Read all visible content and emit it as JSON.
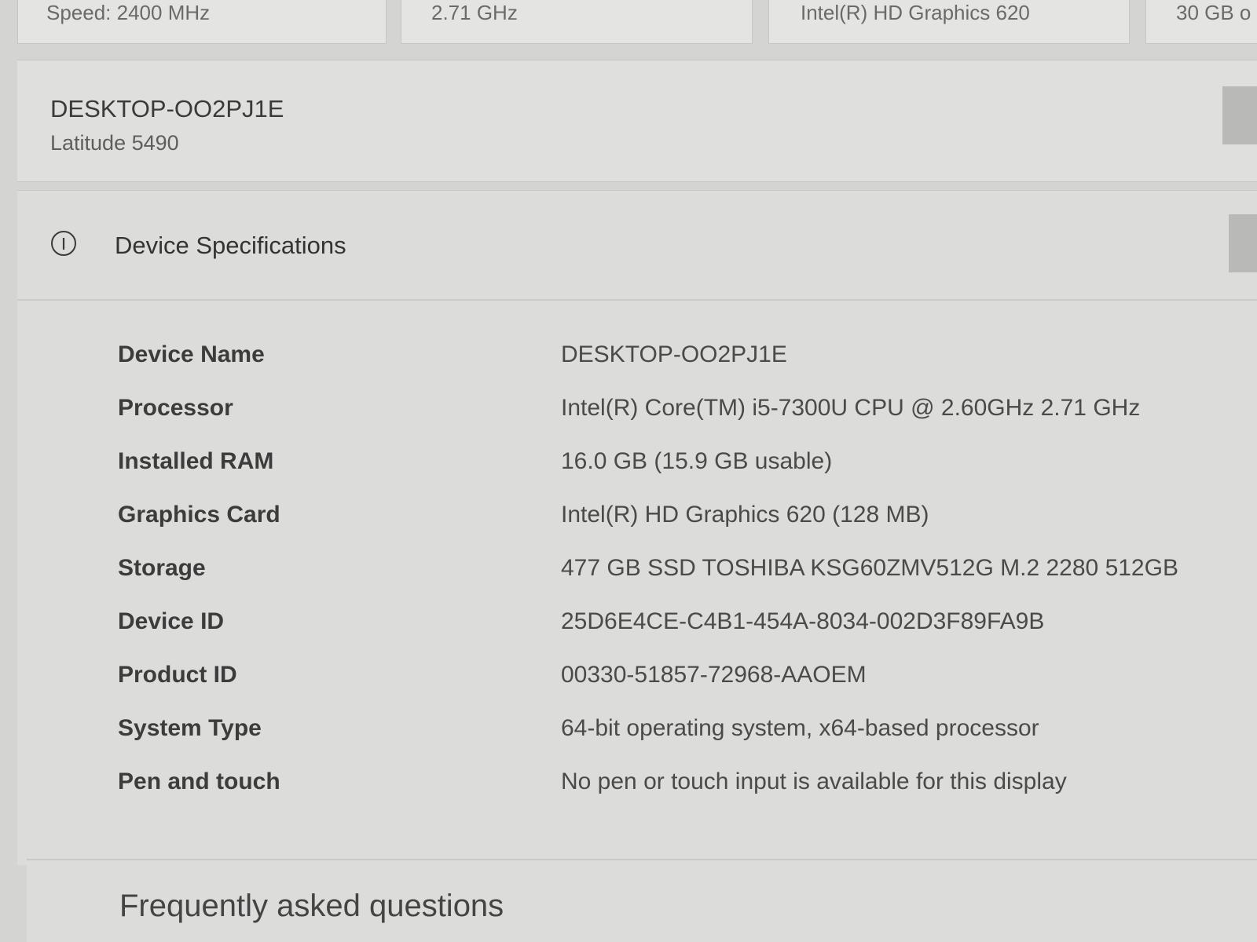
{
  "summary_cards": {
    "ram_speed": "Speed: 2400 MHz",
    "processor_clock": "2.71 GHz",
    "graphics": "Intel(R) HD Graphics 620",
    "storage_partial": "30 GB o"
  },
  "device_header": {
    "name": "DESKTOP-OO2PJ1E",
    "model": "Latitude 5490"
  },
  "specifications": {
    "title": "Device Specifications",
    "icon": "info-icon",
    "rows": [
      {
        "label": "Device Name",
        "value": "DESKTOP-OO2PJ1E"
      },
      {
        "label": "Processor",
        "value": "Intel(R) Core(TM) i5-7300U CPU @ 2.60GHz   2.71 GHz"
      },
      {
        "label": "Installed RAM",
        "value": "16.0 GB (15.9 GB usable)"
      },
      {
        "label": "Graphics Card",
        "value": "Intel(R) HD Graphics 620 (128 MB)"
      },
      {
        "label": "Storage",
        "value": "477 GB SSD TOSHIBA KSG60ZMV512G M.2 2280 512GB"
      },
      {
        "label": "Device ID",
        "value": "25D6E4CE-C4B1-454A-8034-002D3F89FA9B"
      },
      {
        "label": "Product ID",
        "value": "00330-51857-72968-AAOEM"
      },
      {
        "label": "System Type",
        "value": "64-bit operating system, x64-based processor"
      },
      {
        "label": "Pen and touch",
        "value": "No pen or touch input is available for this display"
      }
    ]
  },
  "faq": {
    "title": "Frequently asked questions"
  }
}
